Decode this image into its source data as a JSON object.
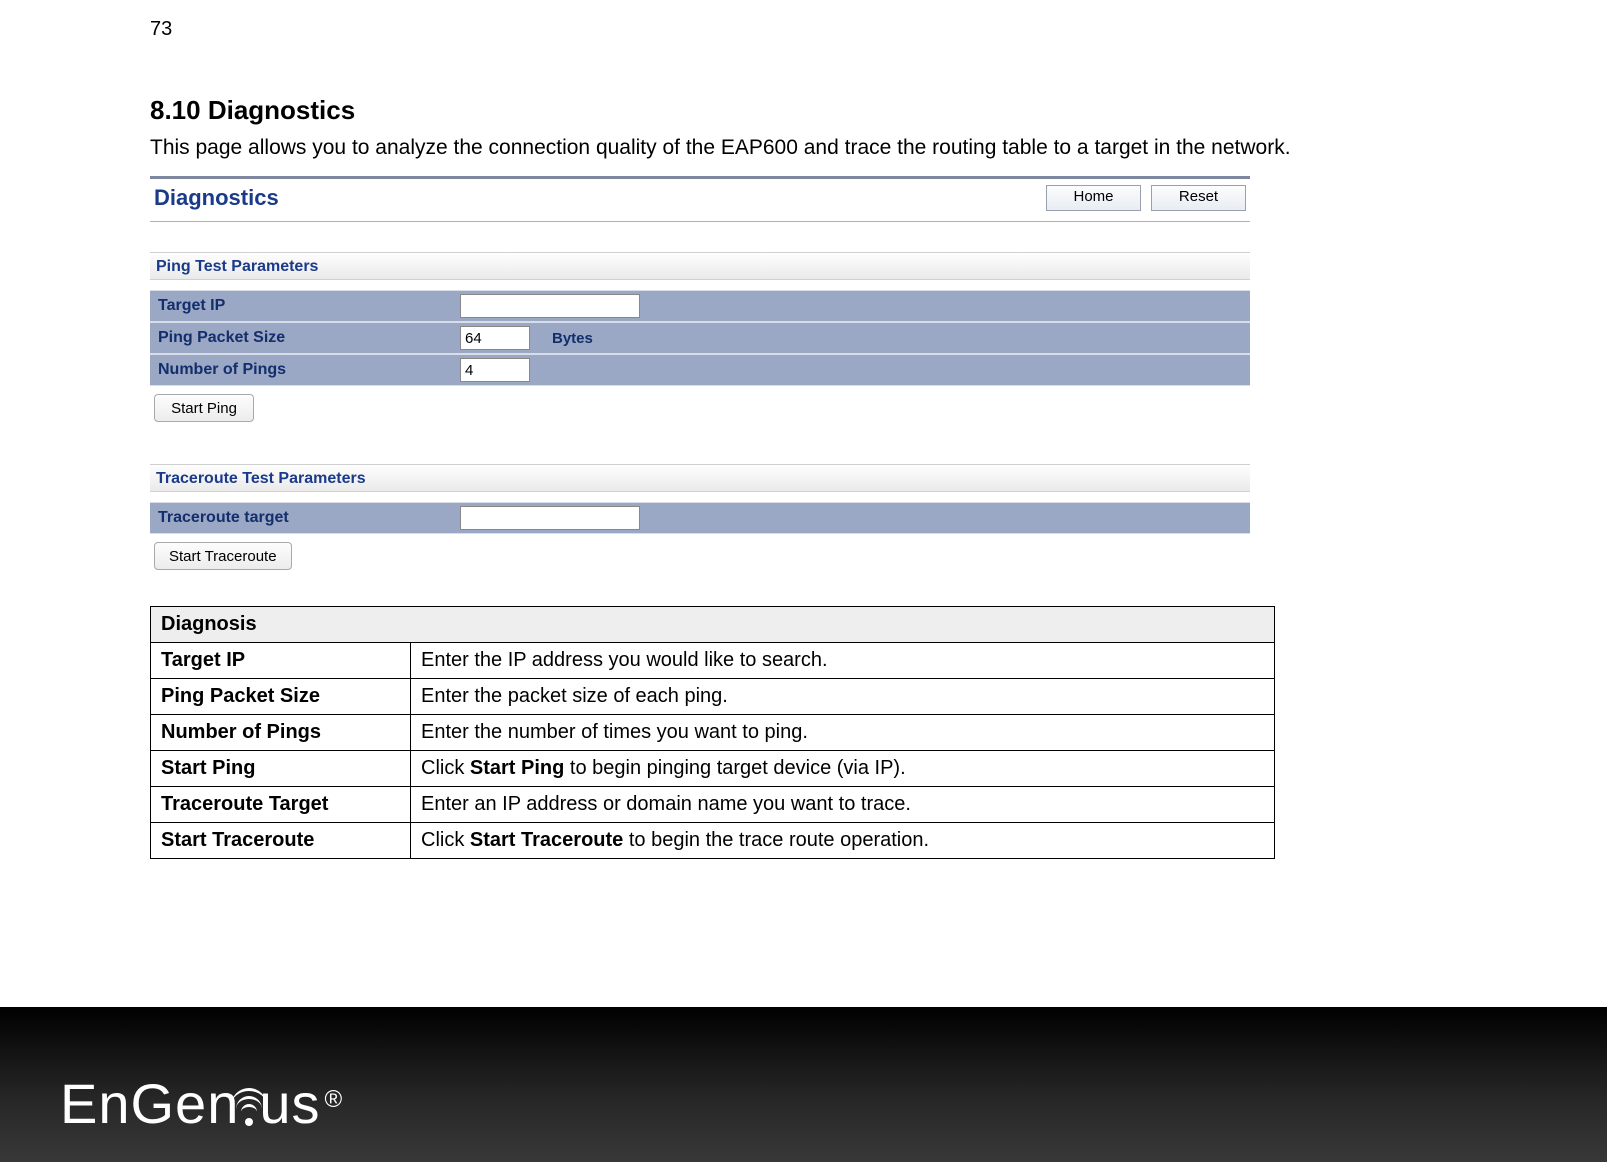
{
  "page_number": "73",
  "section": {
    "title": "8.10 Diagnostics",
    "intro": "This page allows you to analyze the connection quality of the EAP600 and trace the routing table to a target in the network."
  },
  "screenshot": {
    "title": "Diagnostics",
    "home_btn": "Home",
    "reset_btn": "Reset",
    "ping_section": "Ping Test Parameters",
    "rows": {
      "target_ip_label": "Target IP",
      "target_ip_value": "",
      "packet_size_label": "Ping Packet Size",
      "packet_size_value": "64",
      "bytes_label": "Bytes",
      "num_pings_label": "Number of Pings",
      "num_pings_value": "4"
    },
    "start_ping_btn": "Start Ping",
    "trace_section": "Traceroute Test Parameters",
    "trace_target_label": "Traceroute target",
    "trace_target_value": "",
    "start_trace_btn": "Start Traceroute"
  },
  "table": {
    "header": "Diagnosis",
    "rows": [
      {
        "key": "Target IP",
        "pre": "Enter the IP address you would like to search.",
        "bold": "",
        "post": ""
      },
      {
        "key": "Ping Packet Size",
        "pre": "Enter the packet size of each ping.",
        "bold": "",
        "post": ""
      },
      {
        "key": "Number of Pings",
        "pre": "Enter the number of times you want to ping.",
        "bold": "",
        "post": ""
      },
      {
        "key": "Start Ping",
        "pre": "Click ",
        "bold": "Start Ping",
        "post": " to begin pinging target device (via IP)."
      },
      {
        "key": "Traceroute Target",
        "pre": "Enter an IP address or domain name you want to trace.",
        "bold": "",
        "post": ""
      },
      {
        "key": "Start Traceroute",
        "pre": "Click ",
        "bold": "Start Traceroute",
        "post": " to begin the trace route operation."
      }
    ]
  },
  "footer": {
    "brand_pre": "EnGen",
    "brand_post": "us",
    "reg": "®"
  }
}
